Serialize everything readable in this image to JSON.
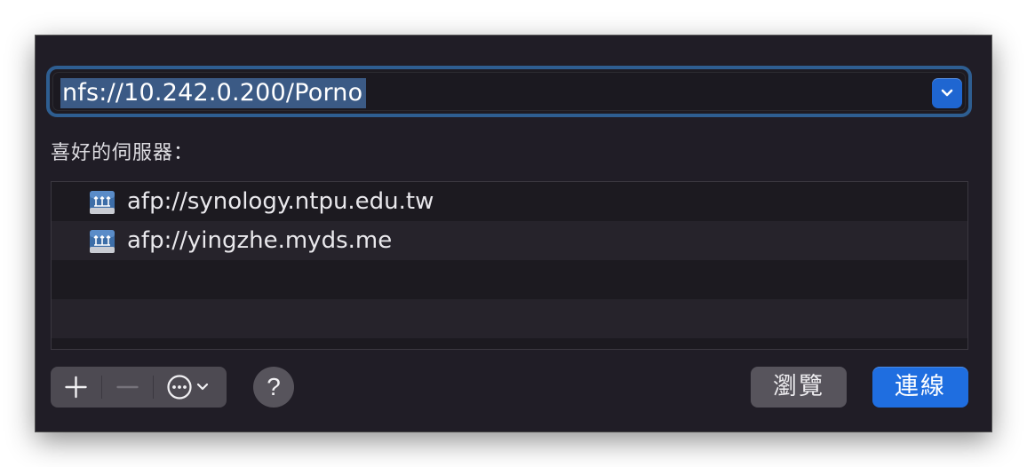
{
  "address": {
    "value": "nfs://10.242.0.200/Porno",
    "dropdown_icon": "chevron-down-icon"
  },
  "favorites": {
    "label": "喜好的伺服器：",
    "items": [
      {
        "label": "afp://synology.ntpu.edu.tw",
        "icon": "network-server-icon"
      },
      {
        "label": "afp://yingzhe.myds.me",
        "icon": "network-server-icon"
      }
    ]
  },
  "toolbar": {
    "add_icon": "plus-icon",
    "remove_icon": "minus-icon",
    "more_icon": "ellipsis-circle-icon",
    "help_label": "?",
    "browse_label": "瀏覽",
    "connect_label": "連線"
  },
  "colors": {
    "accent": "#1f6ee0",
    "selection": "#3b5a85",
    "background": "#201d26"
  }
}
